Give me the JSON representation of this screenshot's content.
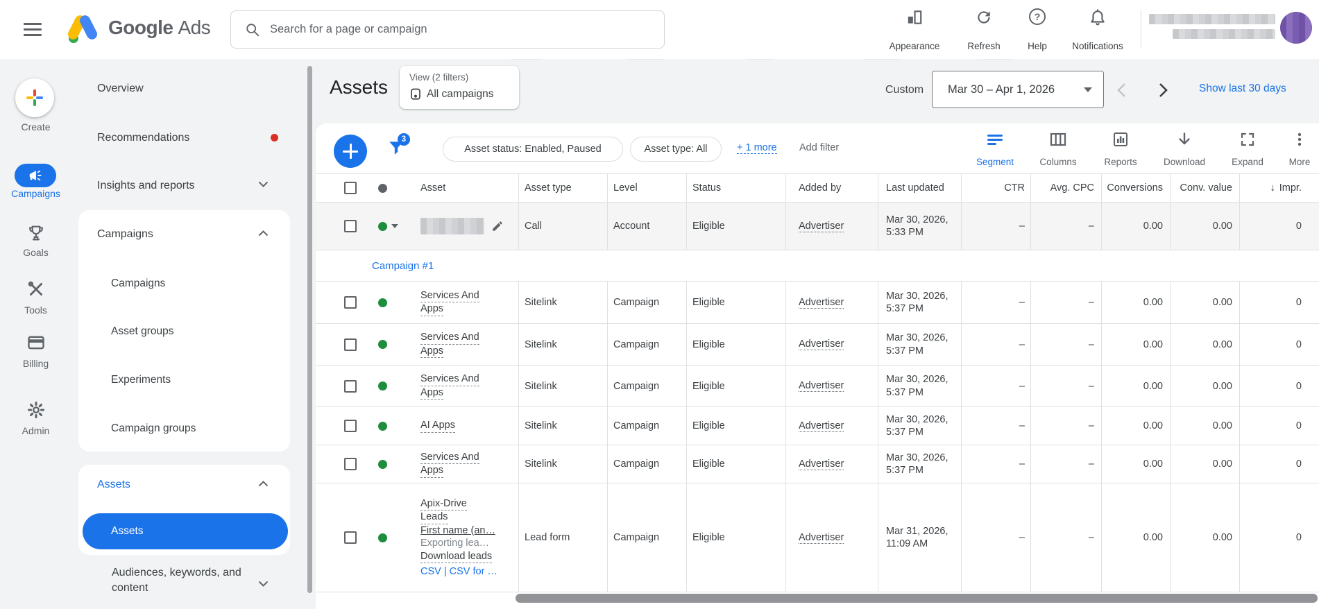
{
  "colors": {
    "accent": "#1a73e8",
    "green": "#1e8e3e",
    "red": "#d93025"
  },
  "topbar": {
    "brand_primary": "Google",
    "brand_secondary": "Ads",
    "search_placeholder": "Search for a page or campaign",
    "actions": [
      {
        "label": "Appearance",
        "icon": "appearance-icon"
      },
      {
        "label": "Refresh",
        "icon": "refresh-icon"
      },
      {
        "label": "Help",
        "icon": "help-icon"
      },
      {
        "label": "Notifications",
        "icon": "notifications-icon"
      }
    ],
    "help_glyph": "?"
  },
  "rail": {
    "create_label": "Create",
    "items": [
      {
        "label": "Campaigns",
        "icon": "megaphone-icon",
        "active": true
      },
      {
        "label": "Goals",
        "icon": "trophy-icon"
      },
      {
        "label": "Tools",
        "icon": "tools-icon"
      },
      {
        "label": "Billing",
        "icon": "billing-icon"
      },
      {
        "label": "Admin",
        "icon": "gear-icon"
      }
    ]
  },
  "nav": {
    "overview": "Overview",
    "recommendations": "Recommendations",
    "insights": "Insights and reports",
    "campaigns_section": {
      "label": "Campaigns",
      "children": [
        "Campaigns",
        "Asset groups",
        "Experiments",
        "Campaign groups"
      ]
    },
    "assets_section": {
      "label": "Assets",
      "children": [
        "Assets"
      ],
      "active_child": "Assets"
    },
    "audiences": "Audiences, keywords, and content"
  },
  "header": {
    "title": "Assets",
    "view_label": "View (2 filters)",
    "view_value": "All campaigns",
    "date_preset": "Custom",
    "date_range": "Mar 30 – Apr 1, 2026",
    "show_last_link": "Show last 30 days"
  },
  "toolbar": {
    "filter_badge": "3",
    "chips": [
      "Asset status: Enabled, Paused",
      "Asset type: All"
    ],
    "more_filters": "+ 1 more",
    "add_filter": "Add filter",
    "actions": [
      {
        "label": "Segment",
        "icon": "segment-icon",
        "active": true
      },
      {
        "label": "Columns",
        "icon": "columns-icon"
      },
      {
        "label": "Reports",
        "icon": "reports-icon"
      },
      {
        "label": "Download",
        "icon": "download-icon"
      },
      {
        "label": "Expand",
        "icon": "expand-icon"
      },
      {
        "label": "More",
        "icon": "more-icon"
      }
    ]
  },
  "table": {
    "columns": [
      "Asset",
      "Asset type",
      "Level",
      "Status",
      "Added by",
      "Last updated",
      "CTR",
      "Avg. CPC",
      "Conversions",
      "Conv. value",
      "Impr."
    ],
    "sort_glyph": "↓",
    "rows": [
      {
        "kind": "data",
        "highlight": true,
        "caret": true,
        "redacted": true,
        "edit": true,
        "type": "Call",
        "level": "Account",
        "status": "Eligible",
        "added_by": "Advertiser",
        "updated": [
          "Mar 30, 2026,",
          "5:33 PM"
        ],
        "ctr": "–",
        "avg_cpc": "–",
        "conversions": "0.00",
        "conv_value": "0.00",
        "impr": "0"
      },
      {
        "kind": "link",
        "label": "Campaign #1"
      },
      {
        "kind": "data",
        "name_lines": [
          {
            "t": "Services And",
            "s": "dashed"
          },
          {
            "t": "Apps",
            "s": "dashed"
          }
        ],
        "type": "Sitelink",
        "level": "Campaign",
        "status": "Eligible",
        "added_by": "Advertiser",
        "updated": [
          "Mar 30, 2026,",
          "5:37 PM"
        ],
        "ctr": "–",
        "avg_cpc": "–",
        "conversions": "0.00",
        "conv_value": "0.00",
        "impr": "0"
      },
      {
        "kind": "data",
        "name_lines": [
          {
            "t": "Services And",
            "s": "dashed"
          },
          {
            "t": "Apps",
            "s": "dashed"
          }
        ],
        "type": "Sitelink",
        "level": "Campaign",
        "status": "Eligible",
        "added_by": "Advertiser",
        "updated": [
          "Mar 30, 2026,",
          "5:37 PM"
        ],
        "ctr": "–",
        "avg_cpc": "–",
        "conversions": "0.00",
        "conv_value": "0.00",
        "impr": "0"
      },
      {
        "kind": "data",
        "name_lines": [
          {
            "t": "Services And",
            "s": "dashed"
          },
          {
            "t": "Apps",
            "s": "dashed"
          }
        ],
        "type": "Sitelink",
        "level": "Campaign",
        "status": "Eligible",
        "added_by": "Advertiser",
        "updated": [
          "Mar 30, 2026,",
          "5:37 PM"
        ],
        "ctr": "–",
        "avg_cpc": "–",
        "conversions": "0.00",
        "conv_value": "0.00",
        "impr": "0"
      },
      {
        "kind": "data",
        "name_lines": [
          {
            "t": "AI Apps",
            "s": "dashed"
          }
        ],
        "type": "Sitelink",
        "level": "Campaign",
        "status": "Eligible",
        "added_by": "Advertiser",
        "updated": [
          "Mar 30, 2026,",
          "5:37 PM"
        ],
        "ctr": "–",
        "avg_cpc": "–",
        "conversions": "0.00",
        "conv_value": "0.00",
        "impr": "0"
      },
      {
        "kind": "data",
        "name_lines": [
          {
            "t": "Services And",
            "s": "dashed"
          },
          {
            "t": "Apps",
            "s": "dashed"
          }
        ],
        "type": "Sitelink",
        "level": "Campaign",
        "status": "Eligible",
        "added_by": "Advertiser",
        "updated": [
          "Mar 30, 2026,",
          "5:37 PM"
        ],
        "ctr": "–",
        "avg_cpc": "–",
        "conversions": "0.00",
        "conv_value": "0.00",
        "impr": "0"
      },
      {
        "kind": "data",
        "name_lines": [
          {
            "t": "Apix-Drive",
            "s": "dashed"
          },
          {
            "t": "Leads",
            "s": "dashed"
          },
          {
            "t": "First name (an…",
            "s": "solid"
          },
          {
            "t": "Exporting lea…",
            "s": "muted"
          },
          {
            "t": "Download leads",
            "s": "dashed"
          },
          {
            "t": "CSV | CSV for …",
            "s": "links"
          }
        ],
        "type": "Lead form",
        "level": "Campaign",
        "status": "Eligible",
        "added_by": "Advertiser",
        "updated": [
          "Mar 31, 2026,",
          "11:09 AM"
        ],
        "ctr": "–",
        "avg_cpc": "–",
        "conversions": "0.00",
        "conv_value": "0.00",
        "impr": "0"
      }
    ]
  }
}
